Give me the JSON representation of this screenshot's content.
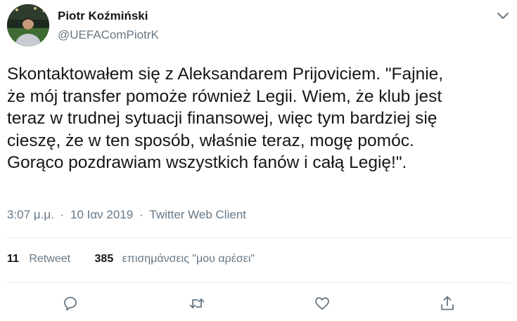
{
  "user": {
    "display_name": "Piotr Koźmiński",
    "handle": "@UEFAComPiotrK"
  },
  "tweet": {
    "lines": [
      "Skontaktowałem się z Aleksandarem Prijoviciem. \"Fajnie,",
      "że mój transfer pomoże również Legii. Wiem, że klub jest",
      "teraz w trudnej sytuacji finansowej, więc tym bardziej się",
      "cieszę, że w ten sposób, właśnie teraz, mogę pomóc.",
      "Gorąco pozdrawiam wszystkich fanów i całą Legię!\"."
    ],
    "time": "3:07 μ.μ.",
    "date": "10 Ιαν 2019",
    "separator": "·",
    "client": "Twitter Web Client"
  },
  "stats": {
    "retweets_count": "11",
    "retweets_label": "Retweet",
    "likes_count": "385",
    "likes_label": "επισημάνσεις \"μου αρέσει\""
  },
  "colors": {
    "text": "#14171a",
    "secondary": "#657786",
    "divider": "#e6ecf0"
  },
  "icons": {
    "caret": "chevron-down-icon",
    "reply": "reply-icon",
    "retweet": "retweet-icon",
    "like": "heart-icon",
    "share": "share-icon"
  }
}
